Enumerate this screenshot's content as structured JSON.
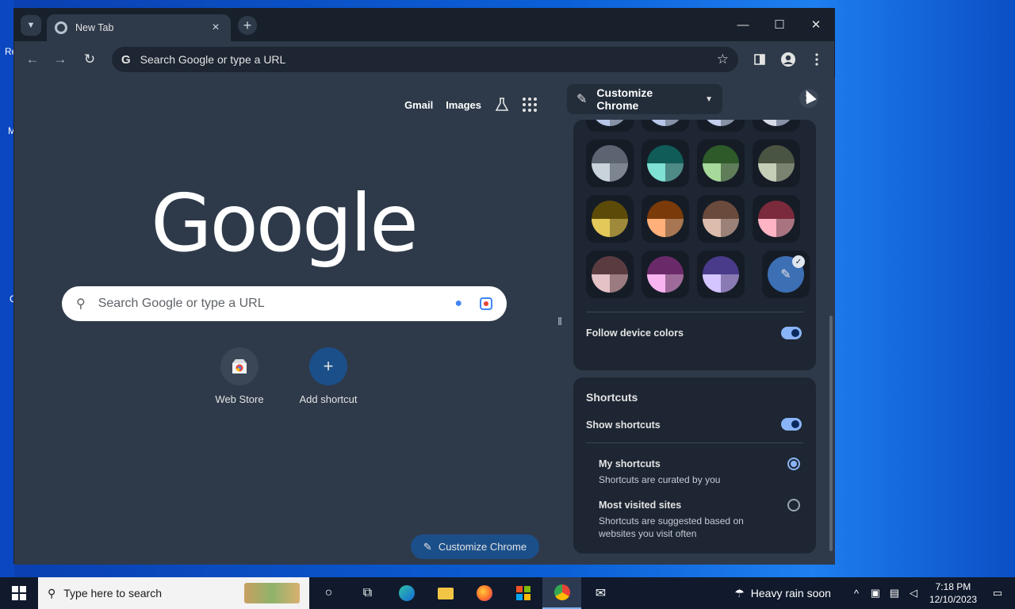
{
  "desktop": {
    "fragments": [
      "Re",
      "M",
      "C"
    ]
  },
  "browser": {
    "tab": {
      "title": "New Tab"
    },
    "window_controls": {
      "minimize": "—",
      "maximize": "☐",
      "close": "✕"
    },
    "toolbar": {
      "back": "←",
      "forward": "→",
      "reload": "↻",
      "omnibox_text": "Search Google or type a URL",
      "star": "☆"
    }
  },
  "ntp": {
    "top_links": {
      "gmail": "Gmail",
      "images": "Images"
    },
    "logo_text": "Google",
    "search_placeholder": "Search Google or type a URL",
    "shortcuts": [
      {
        "label": "Web Store"
      },
      {
        "label": "Add shortcut",
        "icon_glyph": "+"
      }
    ],
    "customize_button": "Customize Chrome"
  },
  "side_panel": {
    "title": "Customize Chrome",
    "close_glyph": "✕",
    "color_rows": [
      [
        {
          "top": "#5b6470",
          "bl": "#c9d3dc",
          "br": "#7d8690"
        },
        {
          "top": "#0f5c58",
          "bl": "#7fe0d4",
          "br": "#4e8a86"
        },
        {
          "top": "#2e5a2a",
          "bl": "#a6d99a",
          "br": "#5f7d58"
        },
        {
          "top": "#4a5442",
          "bl": "#c5cfb8",
          "br": "#7a8370"
        }
      ],
      [
        {
          "top": "#5c4a08",
          "bl": "#e3c85a",
          "br": "#9e8a3a"
        },
        {
          "top": "#7a3a0a",
          "bl": "#ffb07a",
          "br": "#a87652"
        },
        {
          "top": "#6a4a3c",
          "bl": "#dcbcad",
          "br": "#9a8278"
        },
        {
          "top": "#7a2a3a",
          "bl": "#ffb4c4",
          "br": "#a87480"
        }
      ],
      [
        {
          "top": "#5a3c40",
          "bl": "#e4c2c6",
          "br": "#9a7c80"
        },
        {
          "top": "#6a2a6a",
          "bl": "#f7b4f0",
          "br": "#9e6a9a"
        },
        {
          "top": "#4a3a8a",
          "bl": "#d4c4ff",
          "br": "#8a7ab4"
        }
      ]
    ],
    "custom_color_glyph": "✎",
    "check_glyph": "✓",
    "follow_device_colors": "Follow device colors",
    "follow_device_colors_on": true,
    "shortcuts": {
      "title": "Shortcuts",
      "show_shortcuts": "Show shortcuts",
      "show_shortcuts_on": true,
      "options": [
        {
          "title": "My shortcuts",
          "desc": "Shortcuts are curated by you",
          "selected": true
        },
        {
          "title": "Most visited sites",
          "desc": "Shortcuts are suggested based on websites you visit often",
          "selected": false
        }
      ]
    }
  },
  "taskbar": {
    "search_placeholder": "Type here to search",
    "weather": "Heavy rain soon",
    "time": "7:18 PM",
    "date": "12/10/2023"
  }
}
